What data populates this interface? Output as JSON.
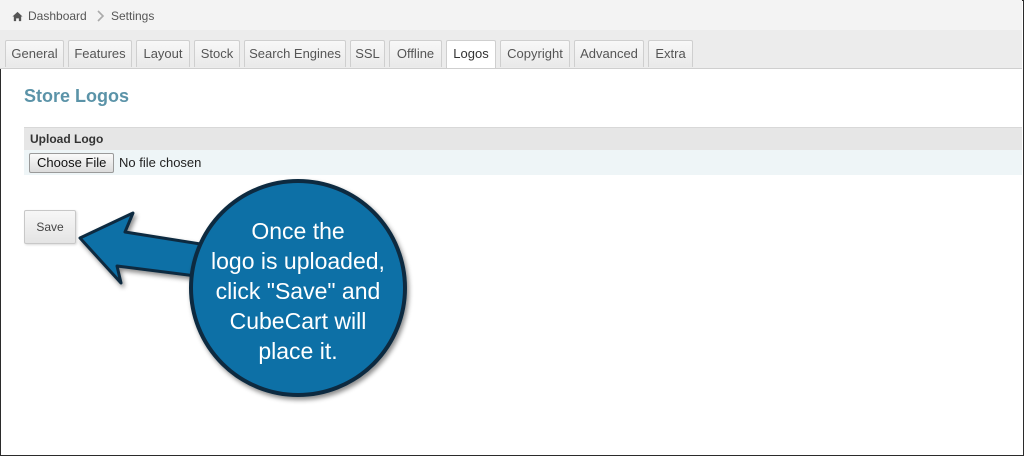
{
  "breadcrumb": {
    "home": "Dashboard",
    "current": "Settings"
  },
  "tabs": [
    {
      "label": "General"
    },
    {
      "label": "Features"
    },
    {
      "label": "Layout"
    },
    {
      "label": "Stock"
    },
    {
      "label": "Search Engines"
    },
    {
      "label": "SSL"
    },
    {
      "label": "Offline"
    },
    {
      "label": "Logos",
      "active": true
    },
    {
      "label": "Copyright"
    },
    {
      "label": "Advanced"
    },
    {
      "label": "Extra"
    }
  ],
  "page": {
    "title": "Store Logos"
  },
  "upload": {
    "header": "Upload Logo",
    "choose_label": "Choose File",
    "status": "No file chosen"
  },
  "actions": {
    "save_label": "Save"
  },
  "callout": {
    "lines": [
      "Once the",
      "logo is uploaded,",
      "click \"Save\" and",
      "CubeCart will",
      "place it."
    ]
  },
  "colors": {
    "title": "#5b93a8",
    "callout_fill": "#0b6fa6",
    "callout_border": "#0a2a3f"
  }
}
